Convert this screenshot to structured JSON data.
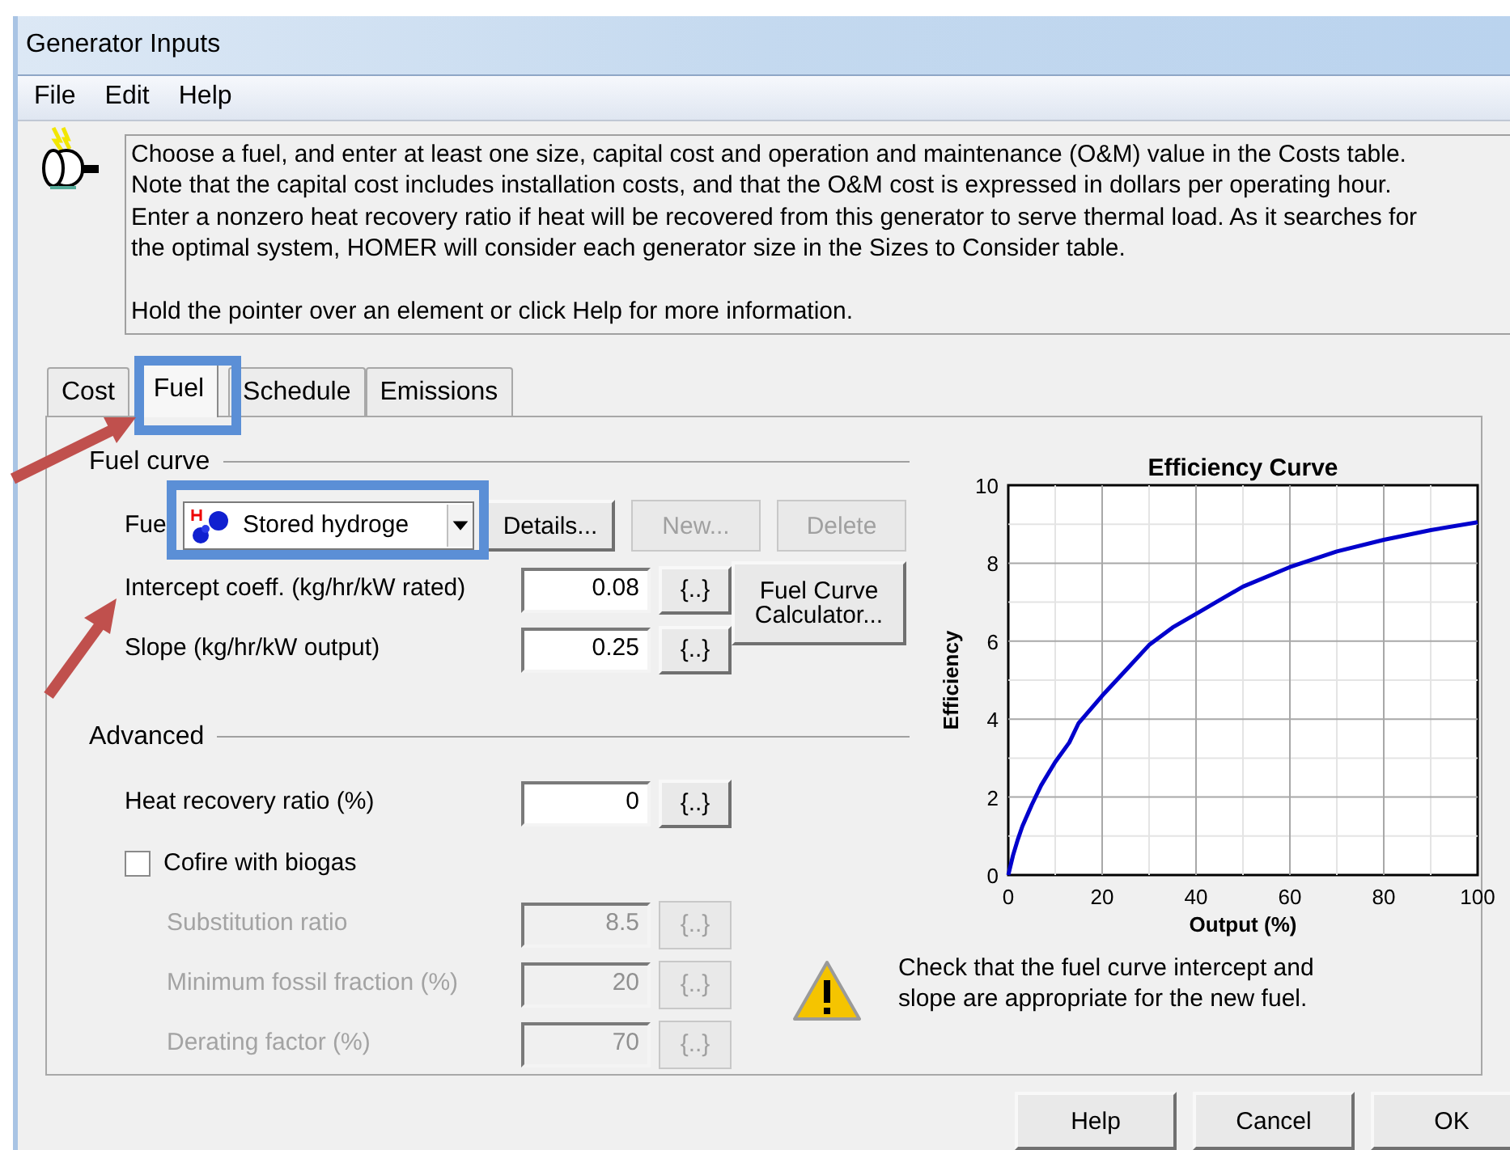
{
  "window": {
    "title": "Generator Inputs"
  },
  "menu": [
    {
      "label": "File"
    },
    {
      "label": "Edit"
    },
    {
      "label": "Help"
    }
  ],
  "info": {
    "paragraphs": [
      "Choose a fuel, and enter at least one size, capital cost and operation and maintenance (O&M) value in the Costs table.\nNote that the capital cost includes installation costs, and that the O&M cost is expressed in dollars per operating hour.\nEnter a nonzero heat recovery ratio if heat will be recovered from this generator to serve thermal load. As it searches for\nthe optimal system, HOMER will consider each generator size in the Sizes to Consider table.",
      "Hold the pointer over an element or click Help for more information."
    ]
  },
  "tabs": [
    {
      "label": "Cost",
      "selected": false
    },
    {
      "label": "Fuel",
      "selected": true
    },
    {
      "label": "Schedule",
      "selected": false
    },
    {
      "label": "Emissions",
      "selected": false
    }
  ],
  "fuel_curve": {
    "heading": "Fuel curve",
    "fuel": {
      "label": "Fue",
      "value": "Stored hydroge"
    },
    "buttons": [
      {
        "label": "Details...",
        "disabled": false
      },
      {
        "label": "New...",
        "disabled": true
      },
      {
        "label": "Delete",
        "disabled": true
      }
    ],
    "fields": [
      {
        "label": "Intercept coeff. (kg/hr/kW rated)",
        "value": "0.08",
        "button": "{..}",
        "disabled": false
      },
      {
        "label": "Slope (kg/hr/kW output)",
        "value": "0.25",
        "button": "{..}",
        "disabled": false
      }
    ],
    "calculator_button": "Fuel Curve Calculator..."
  },
  "advanced": {
    "heading": "Advanced",
    "heat_recovery": {
      "label": "Heat recovery ratio (%)",
      "value": "0",
      "button": "{..}",
      "disabled": false
    },
    "cofire": {
      "label": "Cofire with biogas",
      "checked": false
    },
    "cofire_fields": [
      {
        "label": "Substitution ratio",
        "value": "8.5",
        "button": "{..}",
        "disabled": true
      },
      {
        "label": "Minimum fossil fraction (%)",
        "value": "20",
        "button": "{..}",
        "disabled": true
      },
      {
        "label": "Derating factor (%)",
        "value": "70",
        "button": "{..}",
        "disabled": true
      }
    ]
  },
  "warning": {
    "text": "Check that the fuel curve intercept and\nslope are appropriate for the new fuel."
  },
  "chart": {
    "chart_data": {
      "type": "line",
      "title": "Efficiency Curve",
      "xlabel": "Output (%)",
      "ylabel": "Efficiency",
      "x": [
        0,
        1,
        2,
        3,
        5,
        7,
        10,
        13,
        15,
        20,
        25,
        30,
        35,
        40,
        45,
        50,
        60,
        70,
        80,
        90,
        100
      ],
      "series": [
        {
          "color": "#0000cc",
          "values": [
            0,
            0.5,
            0.9,
            1.25,
            1.8,
            2.3,
            2.9,
            3.4,
            3.9,
            4.6,
            5.25,
            5.9,
            6.35,
            6.7,
            7.05,
            7.4,
            7.9,
            8.3,
            8.6,
            8.85,
            9.05
          ]
        }
      ],
      "grid": true,
      "xlim": [
        0,
        100
      ],
      "ylim": [
        0,
        10
      ],
      "xticks": [
        0,
        20,
        40,
        60,
        80,
        100
      ],
      "yticks": [
        0,
        2,
        4,
        6,
        8,
        10
      ]
    }
  },
  "footer_buttons": [
    {
      "label": "Help"
    },
    {
      "label": "Cancel"
    },
    {
      "label": "OK"
    }
  ]
}
